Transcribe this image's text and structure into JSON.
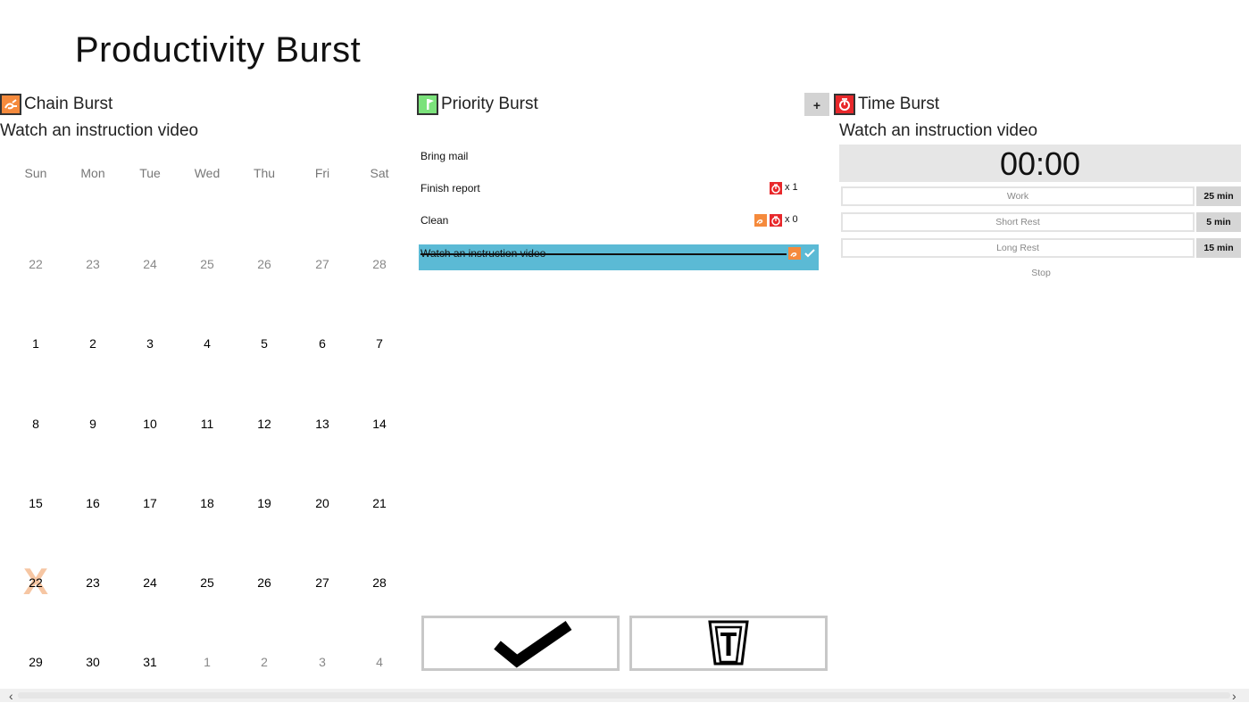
{
  "app": {
    "title": "Productivity Burst"
  },
  "chain": {
    "heading": "Chain Burst",
    "video_link": "Watch an instruction video",
    "accent": "#f58a3c",
    "weekdays": [
      "Sun",
      "Mon",
      "Tue",
      "Wed",
      "Thu",
      "Fri",
      "Sat"
    ],
    "weeks": [
      [
        "22",
        "23",
        "24",
        "25",
        "26",
        "27",
        "28"
      ],
      [
        "1",
        "2",
        "3",
        "4",
        "5",
        "6",
        "7"
      ],
      [
        "8",
        "9",
        "10",
        "11",
        "12",
        "13",
        "14"
      ],
      [
        "15",
        "16",
        "17",
        "18",
        "19",
        "20",
        "21"
      ],
      [
        "22",
        "23",
        "24",
        "25",
        "26",
        "27",
        "28"
      ],
      [
        "29",
        "30",
        "31",
        "1",
        "2",
        "3",
        "4"
      ]
    ],
    "x_mark": "X"
  },
  "priority": {
    "heading": "Priority Burst",
    "accent": "#6ee06e",
    "tasks": [
      {
        "label": "Bring mail"
      },
      {
        "label": "Finish report",
        "count": "x  1"
      },
      {
        "label": "Clean",
        "count": "x  0"
      },
      {
        "label": "Watch an instruction video",
        "selected": true
      }
    ],
    "add_label": "+"
  },
  "time": {
    "heading": "Time Burst",
    "video_link": "Watch an instruction video",
    "accent": "#e8282b",
    "display": "00:00",
    "modes": [
      {
        "label": "Work",
        "duration": "25 min"
      },
      {
        "label": "Short Rest",
        "duration": "5 min"
      },
      {
        "label": "Long Rest",
        "duration": "15 min"
      }
    ],
    "stop_label": "Stop"
  },
  "colors": {
    "selected_row": "#5bbad5"
  },
  "actions": {
    "complete": "check-icon",
    "delete": "trash-icon"
  }
}
